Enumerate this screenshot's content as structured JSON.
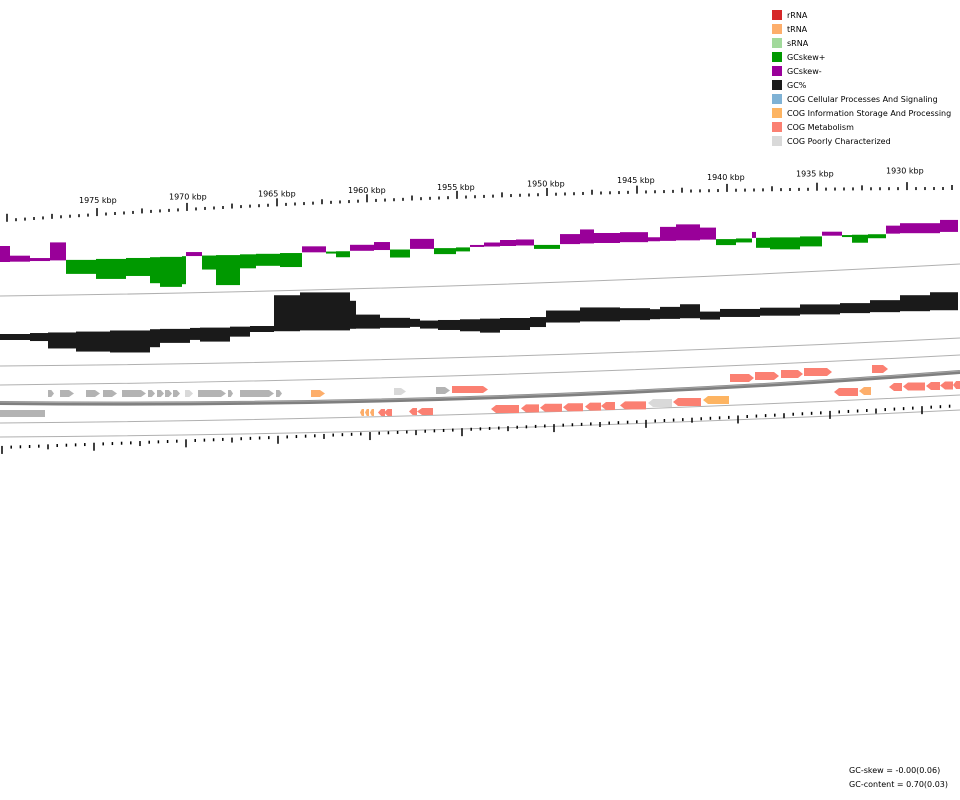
{
  "legend": [
    {
      "label": "rRNA",
      "color": "#d62728"
    },
    {
      "label": "tRNA",
      "color": "#fdae6b"
    },
    {
      "label": "sRNA",
      "color": "#a1d99b"
    },
    {
      "label": "GCskew+",
      "color": "#009900"
    },
    {
      "label": "GCskew-",
      "color": "#990099"
    },
    {
      "label": "GC%",
      "color": "#1a1a1a"
    },
    {
      "label": "COG Cellular Processes And Signaling",
      "color": "#7fb2d5"
    },
    {
      "label": "COG Information Storage And Processing",
      "color": "#fdb462"
    },
    {
      "label": "COG Metabolism",
      "color": "#fb8072"
    },
    {
      "label": "COG Poorly Characterized",
      "color": "#d9d9d9"
    }
  ],
  "scale": {
    "unit": "kbp",
    "labels": [
      "1975 kbp",
      "1970 kbp",
      "1965 kbp",
      "1960 kbp",
      "1955 kbp",
      "1950 kbp",
      "1945 kbp",
      "1940 kbp",
      "1935 kbp",
      "1930 kbp"
    ]
  },
  "stats": {
    "gc_skew": "GC-skew = -0.00(0.06)",
    "gc_content": "GC-content = 0.70(0.03)"
  },
  "colors": {
    "cog_unassigned": "#b3b3b3",
    "cog_poor_light": "#d9d9d9",
    "track_line": "#b0b0b0",
    "backbone": "#7f7f7f"
  }
}
